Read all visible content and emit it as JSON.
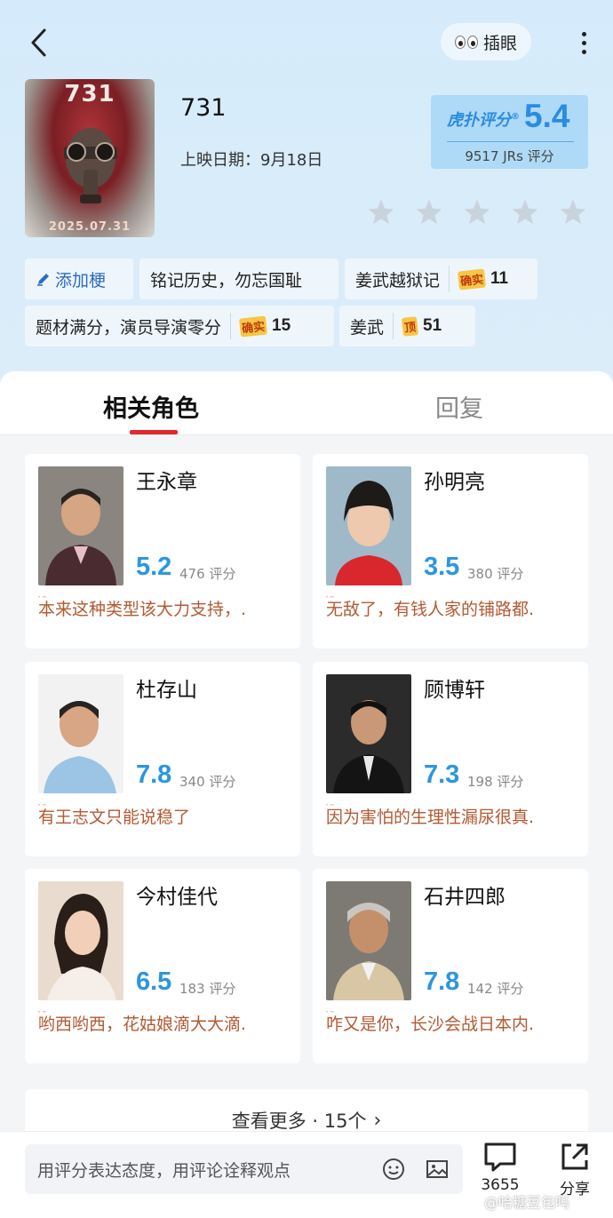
{
  "header": {
    "peek_label": "插眼"
  },
  "movie": {
    "title": "731",
    "poster_title": "731",
    "poster_date": "2025.07.31",
    "release_label": "上映日期：",
    "release_date": "9月18日",
    "score_brand": "虎扑评分",
    "score": "5.4",
    "score_count": "9517 JRs 评分",
    "my_rating_stars": 0
  },
  "tags": [
    {
      "label": "添加梗",
      "type": "add"
    },
    {
      "label": "铭记历史，勿忘国耻"
    },
    {
      "label": "姜武越狱记",
      "badge": "确实",
      "count": "11"
    },
    {
      "label": "题材满分，演员导演零分",
      "badge": "确实",
      "count": "15"
    },
    {
      "label": "姜武",
      "badge": "顶",
      "count": "51"
    }
  ],
  "tabs": {
    "active": "相关角色",
    "other": "回复"
  },
  "characters": [
    {
      "name": "王永章",
      "score": "5.2",
      "count": "476 评分",
      "quote": "本来这种类型该大力支持，."
    },
    {
      "name": "孙明亮",
      "score": "3.5",
      "count": "380 评分",
      "quote": "无敌了，有钱人家的铺路都."
    },
    {
      "name": "杜存山",
      "score": "7.8",
      "count": "340 评分",
      "quote": "有王志文只能说稳了"
    },
    {
      "name": "顾博轩",
      "score": "7.3",
      "count": "198 评分",
      "quote": "因为害怕的生理性漏尿很真."
    },
    {
      "name": "今村佳代",
      "score": "6.5",
      "count": "183 评分",
      "quote": "哟西哟西，花姑娘滴大大滴."
    },
    {
      "name": "石井四郎",
      "score": "7.8",
      "count": "142 评分",
      "quote": "咋又是你，长沙会战日本内."
    }
  ],
  "see_more": "查看更多 · 15个",
  "bottom": {
    "placeholder": "用评分表达态度，用评论诠释观点",
    "comment_count": "3655",
    "share_label": "分享"
  },
  "watermark": "@哈糖豆包吗",
  "colors": {
    "accent": "#2b96e0",
    "tab_underline": "#e3262f",
    "quote": "#b25a32"
  }
}
